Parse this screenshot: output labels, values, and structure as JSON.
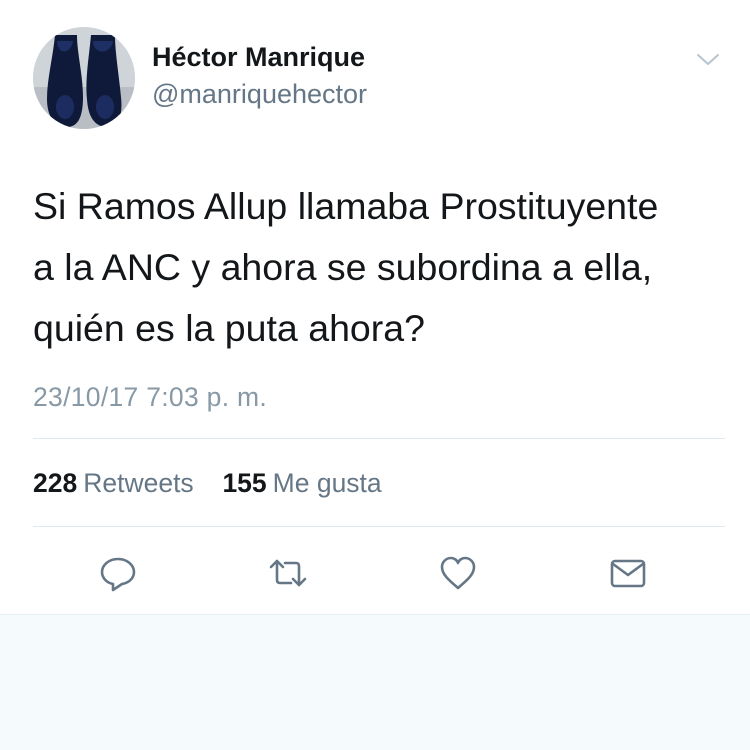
{
  "user": {
    "display_name": "Héctor Manrique",
    "handle": "@manriquehector"
  },
  "tweet": {
    "text": "Si Ramos Allup llamaba Prostituyente\na la ANC y ahora se subordina a ella,\nquién es la puta ahora?",
    "timestamp": "23/10/17 7:03 p. m."
  },
  "stats": {
    "retweets_count": "228",
    "retweets_label": "Retweets",
    "likes_count": "155",
    "likes_label": "Me gusta"
  },
  "icons": {
    "menu": "chevron-down-icon",
    "reply": "reply-icon",
    "retweet": "retweet-icon",
    "like": "heart-icon",
    "dm": "envelope-icon"
  },
  "colors": {
    "name": "#14171a",
    "secondary": "#657786",
    "timestamp": "#8899a6",
    "icon": "#657786",
    "background_below": "#f5fafd"
  }
}
